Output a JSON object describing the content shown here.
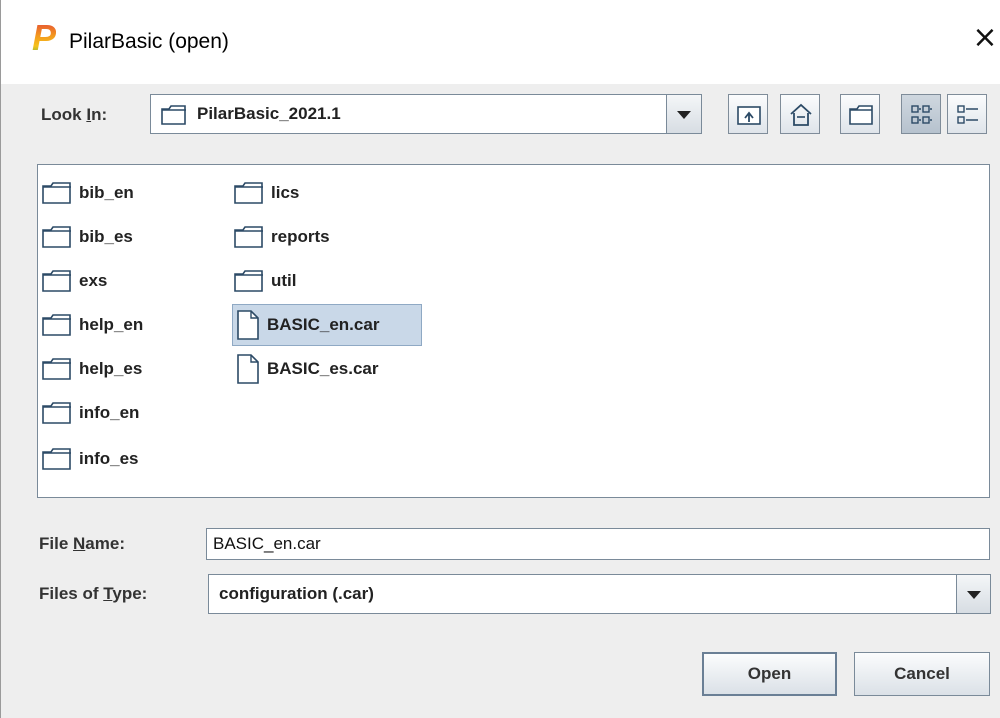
{
  "window": {
    "title": "PilarBasic (open)",
    "logo_letter": "P",
    "close_glyph": "×"
  },
  "look_in": {
    "label_prefix": "Look ",
    "label_mnemonic": "I",
    "label_suffix": "n:",
    "value": "PilarBasic_2021.1"
  },
  "toolbar": {
    "buttons": [
      {
        "name": "up-one-level"
      },
      {
        "name": "home"
      },
      {
        "name": "create-new-folder"
      },
      {
        "name": "list-view",
        "pressed": true
      },
      {
        "name": "details-view"
      }
    ]
  },
  "files": {
    "column1": [
      {
        "name": "bib_en",
        "type": "folder"
      },
      {
        "name": "bib_es",
        "type": "folder"
      },
      {
        "name": "exs",
        "type": "folder"
      },
      {
        "name": "help_en",
        "type": "folder"
      },
      {
        "name": "help_es",
        "type": "folder"
      },
      {
        "name": "info_en",
        "type": "folder"
      },
      {
        "name": "info_es",
        "type": "folder"
      }
    ],
    "column2": [
      {
        "name": "lics",
        "type": "folder"
      },
      {
        "name": "reports",
        "type": "folder"
      },
      {
        "name": "util",
        "type": "folder"
      },
      {
        "name": "BASIC_en.car",
        "type": "file",
        "selected": true
      },
      {
        "name": "BASIC_es.car",
        "type": "file"
      }
    ]
  },
  "file_name": {
    "label_prefix": "File ",
    "label_mnemonic": "N",
    "label_suffix": "ame:",
    "value": "BASIC_en.car"
  },
  "file_type": {
    "label_prefix": "Files of ",
    "label_mnemonic": "T",
    "label_suffix": "ype:",
    "value": "configuration (.car)"
  },
  "buttons": {
    "open": "Open",
    "cancel": "Cancel"
  },
  "colors": {
    "selection": "#c9d8e8",
    "background": "#eeeeee"
  }
}
